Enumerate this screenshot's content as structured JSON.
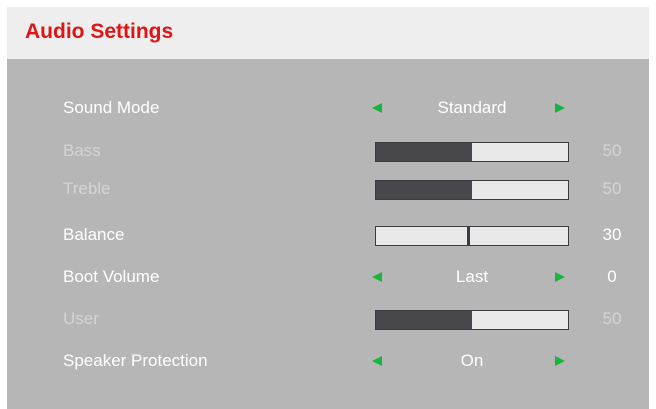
{
  "header": {
    "title": "Audio Settings"
  },
  "colors": {
    "title": "#e01414",
    "arrow": "#16b53c",
    "panel": "#b6b6b6",
    "header": "#eeeeee"
  },
  "icons": {
    "prev": "triangle-left",
    "next": "triangle-right"
  },
  "settings": {
    "sound_mode": {
      "label": "Sound Mode",
      "value": "Standard"
    },
    "bass": {
      "label": "Bass",
      "value": "50",
      "level": 0.5,
      "enabled": false
    },
    "treble": {
      "label": "Treble",
      "value": "50",
      "level": 0.5,
      "enabled": false
    },
    "balance": {
      "label": "Balance",
      "value": "30",
      "level": 0.48
    },
    "boot_volume": {
      "label": "Boot Volume",
      "option": "Last",
      "value": "0"
    },
    "user": {
      "label": "User",
      "value": "50",
      "level": 0.5,
      "enabled": false
    },
    "speaker_protection": {
      "label": "Speaker Protection",
      "value": "On"
    }
  }
}
